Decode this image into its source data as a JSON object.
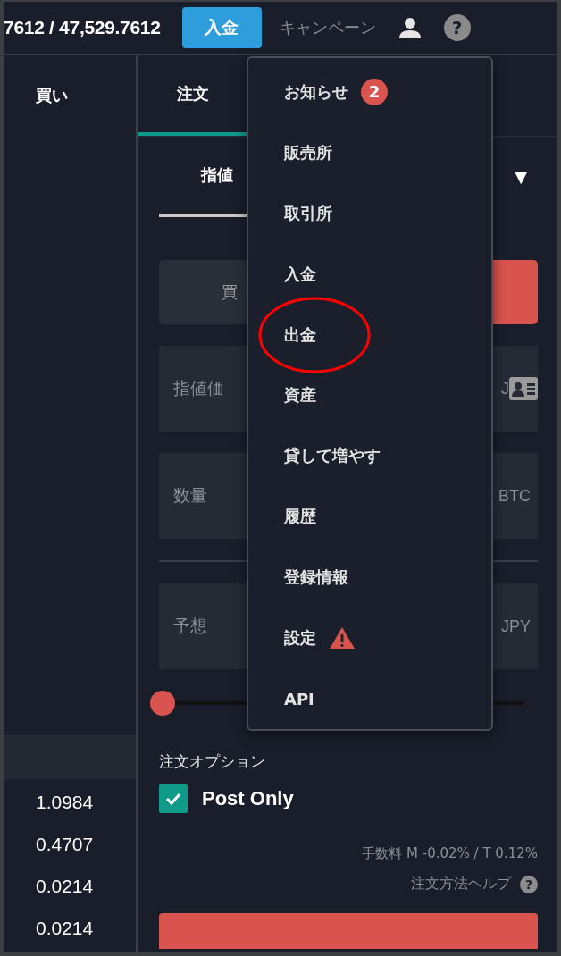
{
  "header": {
    "price": "7612 / 47,529.7612",
    "deposit_button": "入金",
    "campaign_link": "キャンペーン",
    "help_icon": "?"
  },
  "book": {
    "heading": "買い",
    "sizes": [
      "1.0984",
      "0.4707",
      "0.0214",
      "0.0214"
    ]
  },
  "order_tabs": [
    {
      "label": "注文",
      "selected": true
    }
  ],
  "order_type_tabs": [
    {
      "label": "指値",
      "selected": true
    }
  ],
  "dropdown_caret": "▼",
  "side_toggle": [
    {
      "label": "買",
      "selected": false
    },
    {
      "selected": true
    }
  ],
  "fields": [
    {
      "placeholder": "指値価",
      "suffix": "J",
      "card_icon": true
    },
    {
      "placeholder": "数量",
      "suffix": "BTC",
      "card_icon": false
    },
    {
      "placeholder": "予想",
      "suffix": "JPY",
      "card_icon": false
    }
  ],
  "slider": {
    "level": 0
  },
  "options": {
    "heading": "注文オプション",
    "post_only": {
      "label": "Post Only",
      "checked": true
    }
  },
  "fee": "手数料 M -0.02% / T 0.12%",
  "help_link": "注文方法ヘルプ",
  "help_link_icon": "?",
  "menu": [
    {
      "label": "お知らせ",
      "badge": "2",
      "warning": false,
      "circled": false
    },
    {
      "label": "販売所",
      "warning": false,
      "circled": false
    },
    {
      "label": "取引所",
      "warning": false,
      "circled": false
    },
    {
      "label": "入金",
      "warning": false,
      "circled": false
    },
    {
      "label": "出金",
      "warning": false,
      "circled": true
    },
    {
      "label": "資産",
      "warning": false,
      "circled": false
    },
    {
      "label": "貸して増やす",
      "warning": false,
      "circled": false
    },
    {
      "label": "履歴",
      "warning": false,
      "circled": false
    },
    {
      "label": "登録情報",
      "warning": false,
      "circled": false
    },
    {
      "label": "設定",
      "warning": true,
      "circled": false
    },
    {
      "label": "API",
      "warning": false,
      "circled": false
    }
  ]
}
